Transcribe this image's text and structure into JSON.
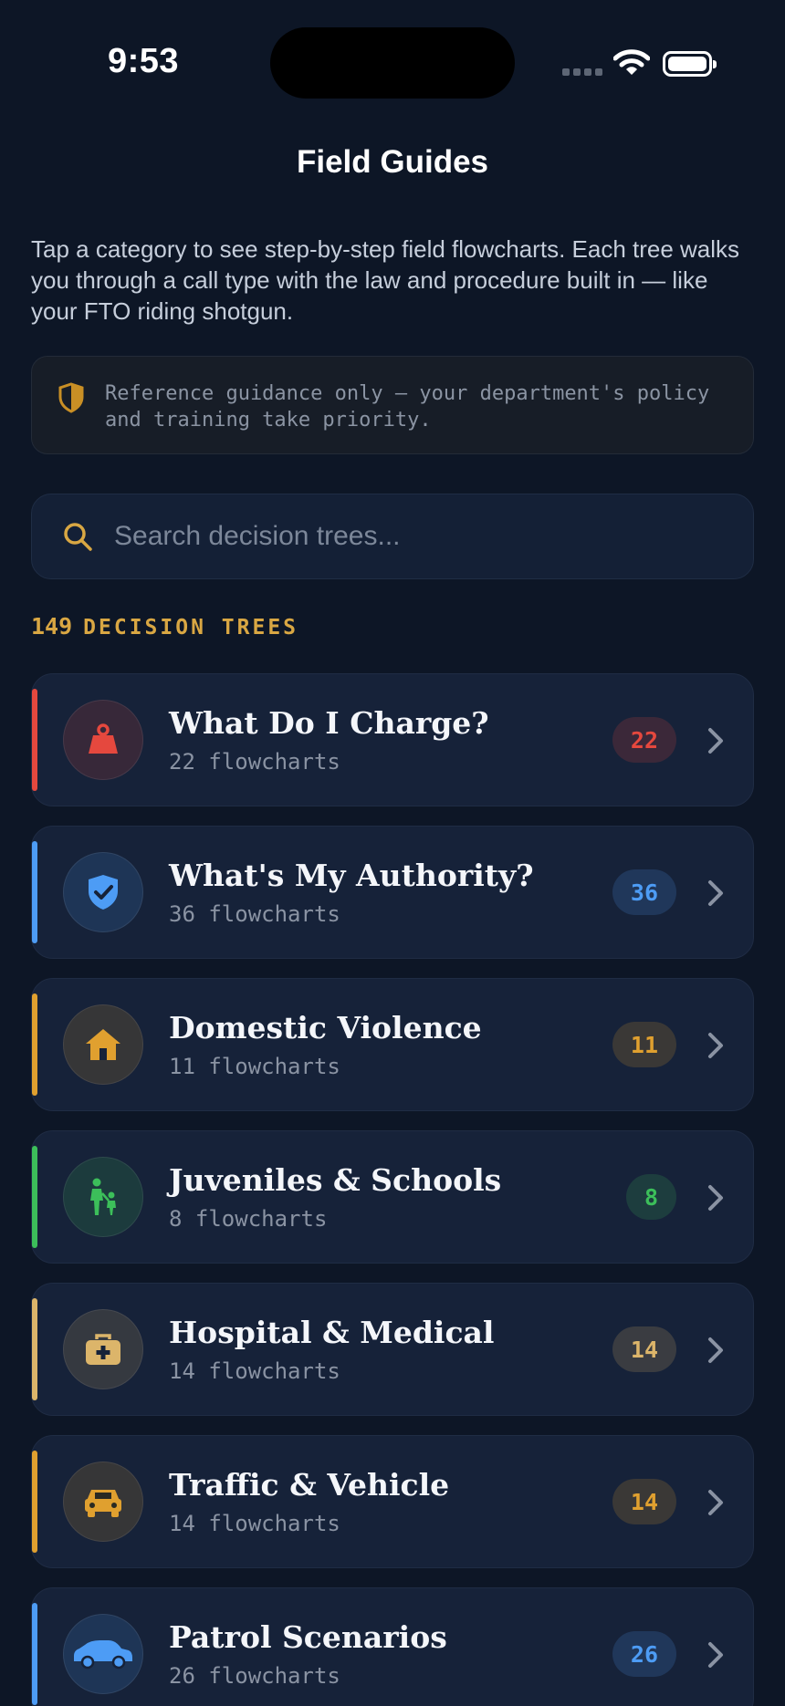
{
  "status_bar": {
    "time": "9:53"
  },
  "nav": {
    "title": "Field Guides"
  },
  "intro": "Tap a category to see step-by-step field flowcharts. Each tree walks you through a call type with the law and procedure built in — like your FTO riding shotgun.",
  "notice": {
    "text": "Reference guidance only — your department's policy and training take priority.",
    "icon": "shield-icon",
    "color": "#c98f25"
  },
  "search": {
    "placeholder": "Search decision trees...",
    "value": "",
    "icon": "search-icon",
    "color": "#d9a743"
  },
  "tree_count": {
    "number": "149",
    "label": "DECISION TREES"
  },
  "categories": [
    {
      "title": "What Do I Charge?",
      "subtitle": "22 flowcharts",
      "count": "22",
      "icon": "weight-icon",
      "color": "#e5483e"
    },
    {
      "title": "What's My Authority?",
      "subtitle": "36 flowcharts",
      "count": "36",
      "icon": "shield-check-icon",
      "color": "#4d9cf5"
    },
    {
      "title": "Domestic Violence",
      "subtitle": "11 flowcharts",
      "count": "11",
      "icon": "house-icon",
      "color": "#e0a02f"
    },
    {
      "title": "Juveniles & Schools",
      "subtitle": "8 flowcharts",
      "count": "8",
      "icon": "parent-child-icon",
      "color": "#3cbf5a"
    },
    {
      "title": "Hospital & Medical",
      "subtitle": "14 flowcharts",
      "count": "14",
      "icon": "medical-kit-icon",
      "color": "#dcb56a"
    },
    {
      "title": "Traffic & Vehicle",
      "subtitle": "14 flowcharts",
      "count": "14",
      "icon": "car-front-icon",
      "color": "#e0a02f"
    },
    {
      "title": "Patrol Scenarios",
      "subtitle": "26 flowcharts",
      "count": "26",
      "icon": "car-side-icon",
      "color": "#4d9cf5"
    }
  ]
}
